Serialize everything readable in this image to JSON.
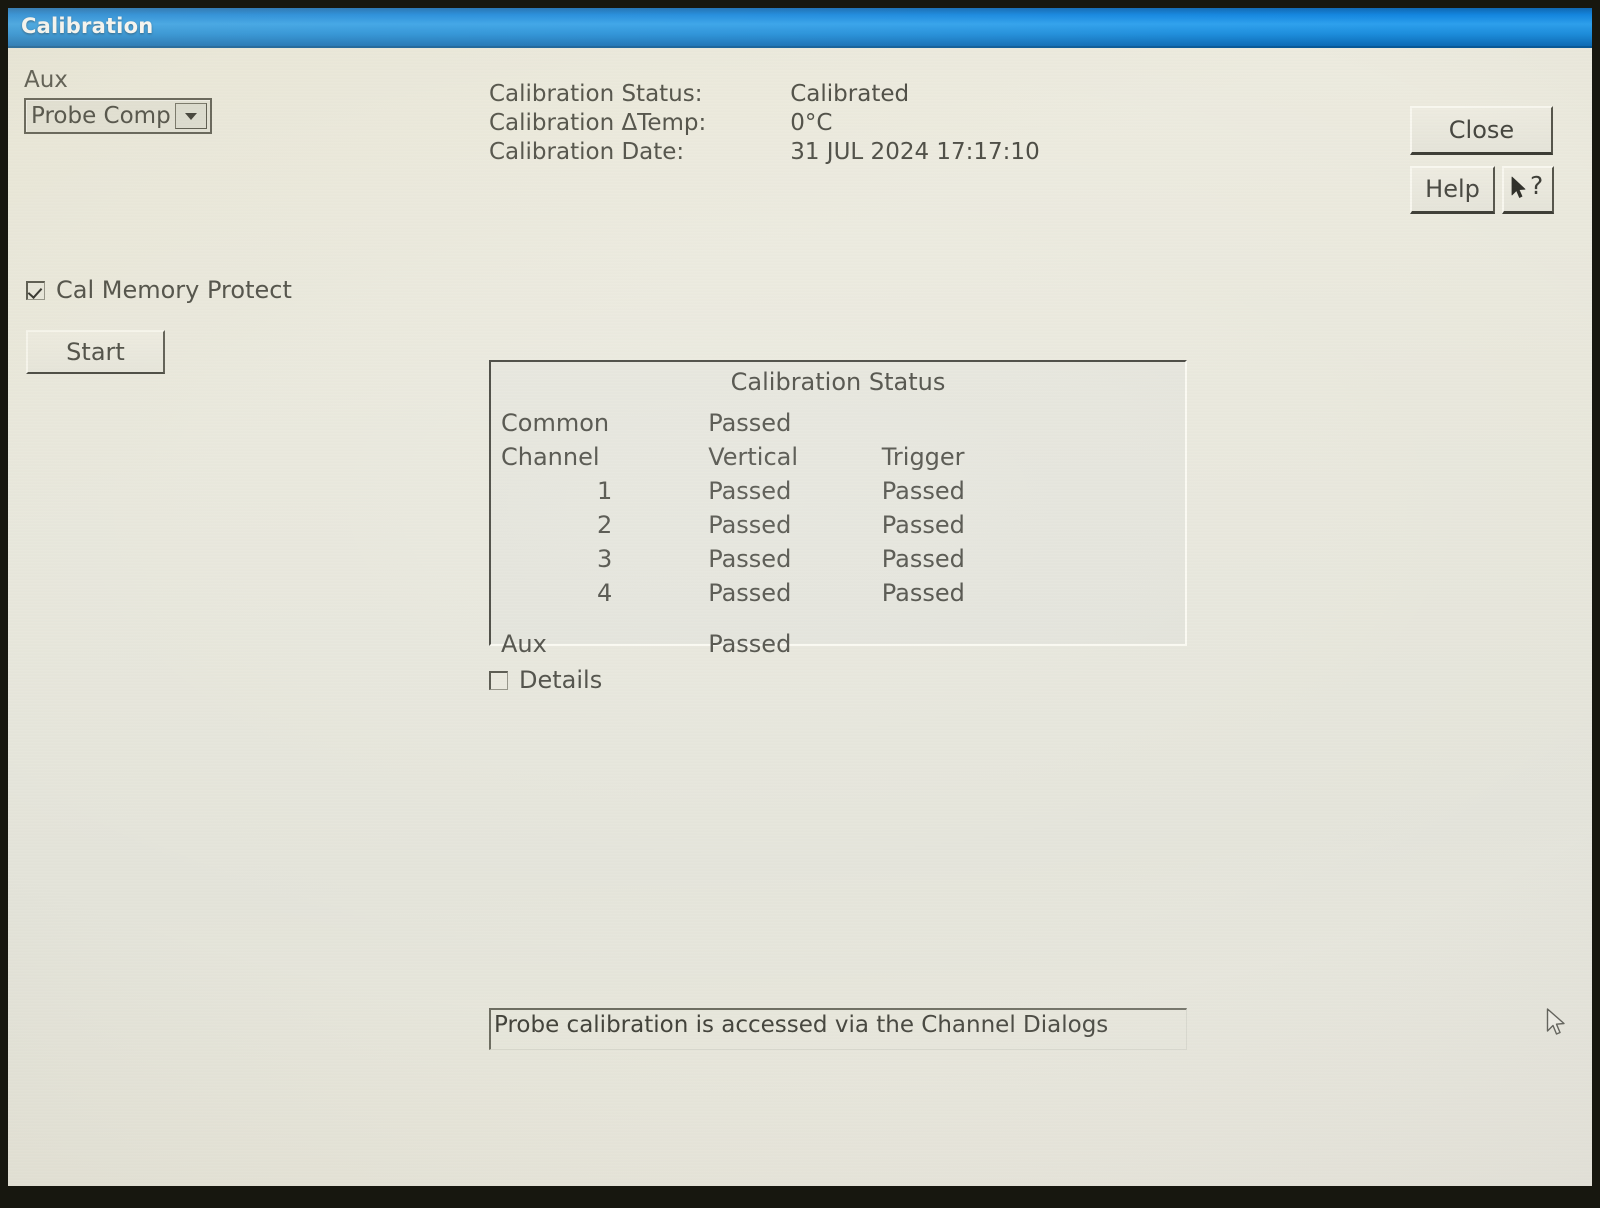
{
  "window": {
    "title": "Calibration"
  },
  "aux": {
    "label": "Aux",
    "selected": "Probe Comp",
    "options": [
      "Probe Comp"
    ]
  },
  "cal_info": {
    "rows": [
      {
        "key": "Calibration Status:",
        "value": "Calibrated"
      },
      {
        "key": "Calibration ΔTemp:",
        "value": "0°C"
      },
      {
        "key": "Calibration Date:",
        "value": "31 JUL 2024 17:17:10"
      }
    ]
  },
  "buttons": {
    "close": "Close",
    "help": "Help",
    "context_help": "?",
    "start": "Start"
  },
  "cal_memory_protect": {
    "label": "Cal Memory Protect",
    "checked": true
  },
  "cal_status_panel": {
    "title": "Calibration Status",
    "common": {
      "label": "Common",
      "value": "Passed"
    },
    "headers": {
      "channel": "Channel",
      "vertical": "Vertical",
      "trigger": "Trigger"
    },
    "channels": [
      {
        "channel": "1",
        "vertical": "Passed",
        "trigger": "Passed"
      },
      {
        "channel": "2",
        "vertical": "Passed",
        "trigger": "Passed"
      },
      {
        "channel": "3",
        "vertical": "Passed",
        "trigger": "Passed"
      },
      {
        "channel": "4",
        "vertical": "Passed",
        "trigger": "Passed"
      }
    ],
    "aux": {
      "label": "Aux",
      "value": "Passed"
    }
  },
  "details": {
    "label": "Details",
    "checked": false
  },
  "message_bar": {
    "text": "Probe calibration is accessed via the Channel Dialogs"
  },
  "colors": {
    "titlebar_blue": "#1186e2",
    "dialog_background": "#e8e7dc",
    "text": "#43433b",
    "border_dark": "#3e3e36",
    "border_light": "#fbfaf2"
  }
}
